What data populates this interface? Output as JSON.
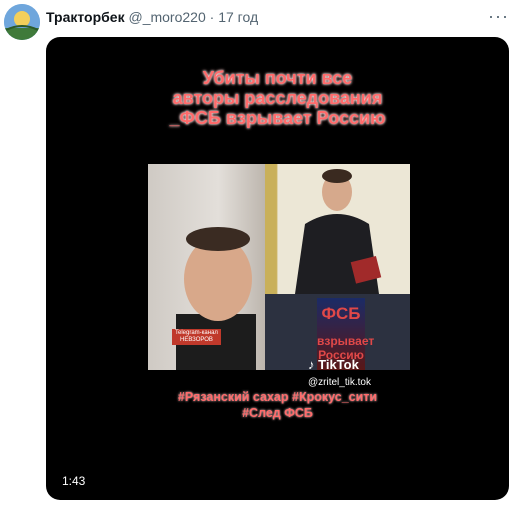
{
  "tweet": {
    "display_name": "Тракторбек",
    "handle": "@_moro220",
    "separator": "·",
    "time": "17 год",
    "more_icon": "more-icon"
  },
  "video": {
    "title_lines": [
      "Убиты почти все",
      "авторы расследования",
      "_ФСБ взрывает Россию"
    ],
    "telegram_badge": [
      "Telegram-канал",
      "НЕВЗОРОВ"
    ],
    "book_title": "ФСБ",
    "book_subtitle": "взрывает Россию",
    "tiktok_label": "TikTok",
    "tiktok_handle": "@zritel_tik.tok",
    "hashtags": [
      "#Рязанский сахар #Крокус_сити",
      "#След ФСБ"
    ],
    "duration": "1:43",
    "accent_color": "#ff6b6b"
  }
}
